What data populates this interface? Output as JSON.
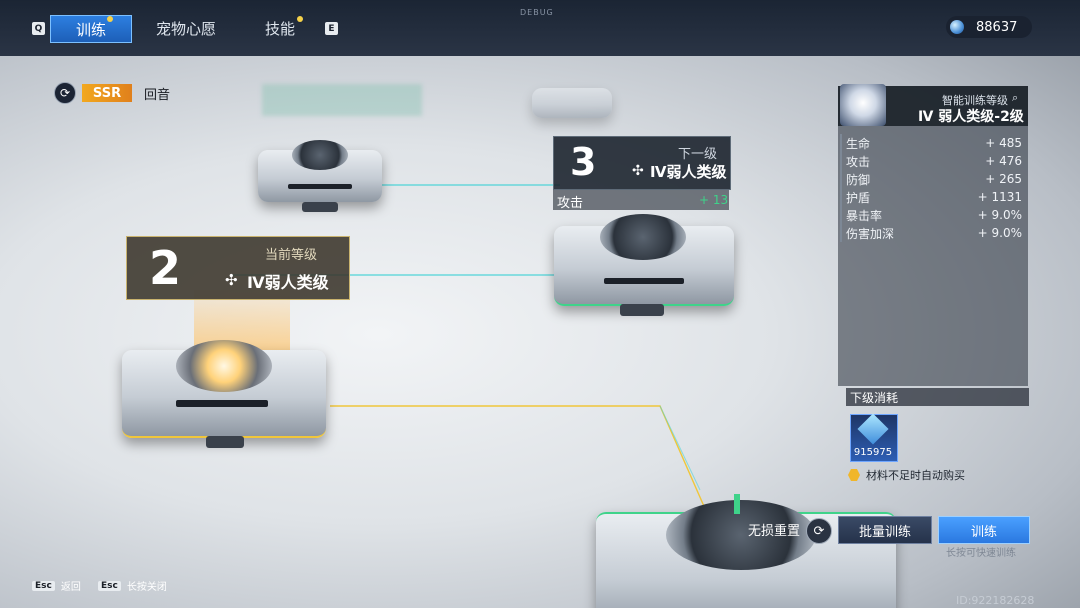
{
  "top_bar": {
    "key_left": "Q",
    "key_right": "E",
    "tabs": [
      {
        "label": "训练",
        "active": true,
        "dot": true
      },
      {
        "label": "宠物心愿",
        "active": false,
        "dot": false
      },
      {
        "label": "技能",
        "active": false,
        "dot": true
      }
    ],
    "debug_text": "DEBUG",
    "currency_value": "88637"
  },
  "echo": {
    "rarity": "SSR",
    "name": "回音"
  },
  "current_level": {
    "number": "2",
    "label": "当前等级",
    "rank": "Ⅳ弱人类级"
  },
  "next_level": {
    "number": "3",
    "label": "下一级",
    "rank": "Ⅳ弱人类级",
    "attr_name": "攻击",
    "attr_value": "+ 13"
  },
  "panel": {
    "title": "智能训练等级",
    "level": "Ⅳ 弱人类级-2级",
    "stats": [
      {
        "name": "生命",
        "value": "+ 485"
      },
      {
        "name": "攻击",
        "value": "+ 476"
      },
      {
        "name": "防御",
        "value": "+ 265"
      },
      {
        "name": "护盾",
        "value": "+ 1131"
      },
      {
        "name": "暴击率",
        "value": "+ 9.0%"
      },
      {
        "name": "伤害加深",
        "value": "+ 9.0%"
      }
    ],
    "cost_title": "下级消耗",
    "cost_quantity": "915975",
    "auto_buy": "材料不足时自动购买"
  },
  "actions": {
    "reset_label": "无损重置",
    "batch_train": "批量训练",
    "train": "训练",
    "hold_tip": "长按可快速训练"
  },
  "footer": {
    "esc_key": "Esc",
    "back": "返回",
    "esc_key2": "Esc",
    "long_press_close": "长按关闭",
    "build_id": "ID:922182628"
  },
  "colors": {
    "accent_blue": "#2a78e0",
    "ssr_orange": "#e0901c",
    "link_cyan": "#4fd4d8",
    "link_yellow": "#f0c63a",
    "stat_green": "#3fd38a"
  }
}
